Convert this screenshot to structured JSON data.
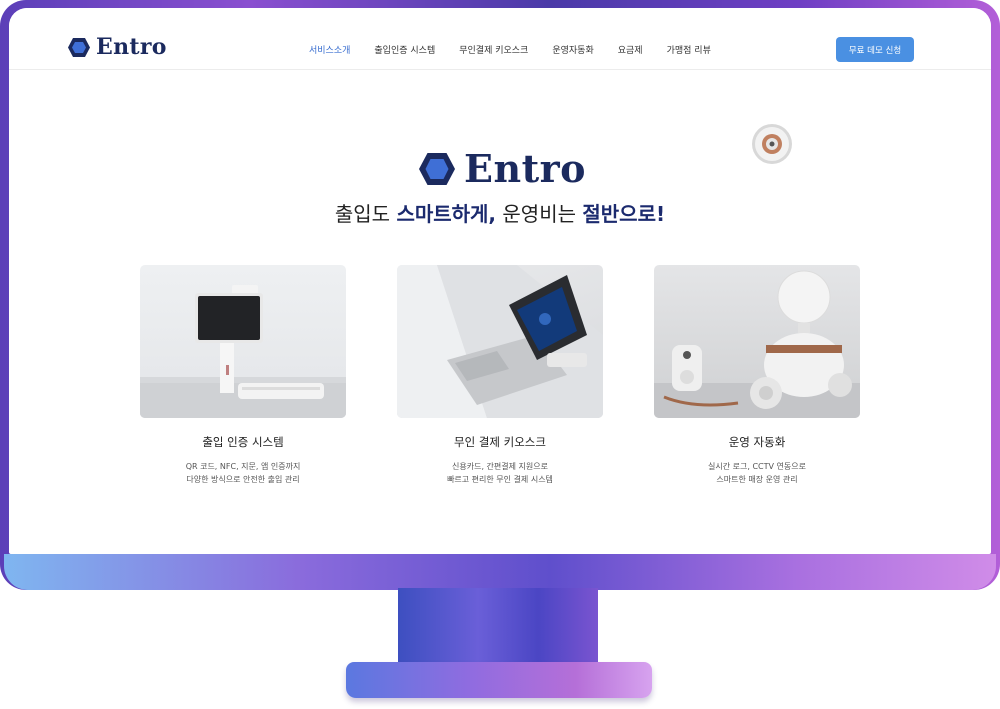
{
  "header": {
    "logo": "Entro",
    "nav": [
      {
        "label": "서비스소개",
        "active": true
      },
      {
        "label": "출입인증 시스템",
        "active": false
      },
      {
        "label": "무인결제 키오스크",
        "active": false
      },
      {
        "label": "운영자동화",
        "active": false
      },
      {
        "label": "요금제",
        "active": false
      },
      {
        "label": "가맹점 리뷰",
        "active": false
      }
    ],
    "cta_label": "무료 데모 신청"
  },
  "hero": {
    "logo": "Entro",
    "tagline_1": "출입도 ",
    "tagline_hl1": "스마트하게,",
    "tagline_2": " 운영비는 ",
    "tagline_hl2": "절반으로!"
  },
  "cards": [
    {
      "title": "출입 인증 시스템",
      "desc_1": "QR 코드, NFC, 지문, 앱 인증까지",
      "desc_2": "다양한 방식으로 안전한 출입 관리"
    },
    {
      "title": "무인 결제 키오스크",
      "desc_1": "신용카드, 간편결제 지원으로",
      "desc_2": "빠르고 편리한 무인 결제 시스템"
    },
    {
      "title": "운영 자동화",
      "desc_1": "실시간 로그, CCTV 연동으로",
      "desc_2": "스마트한 매장 운영 관리"
    }
  ],
  "colors": {
    "brand_navy": "#1b2a5e",
    "accent_blue": "#4a90e2",
    "nav_active": "#3a6fd0"
  },
  "icons": [
    "hexagon-logo-icon",
    "device-decoration-icon"
  ]
}
